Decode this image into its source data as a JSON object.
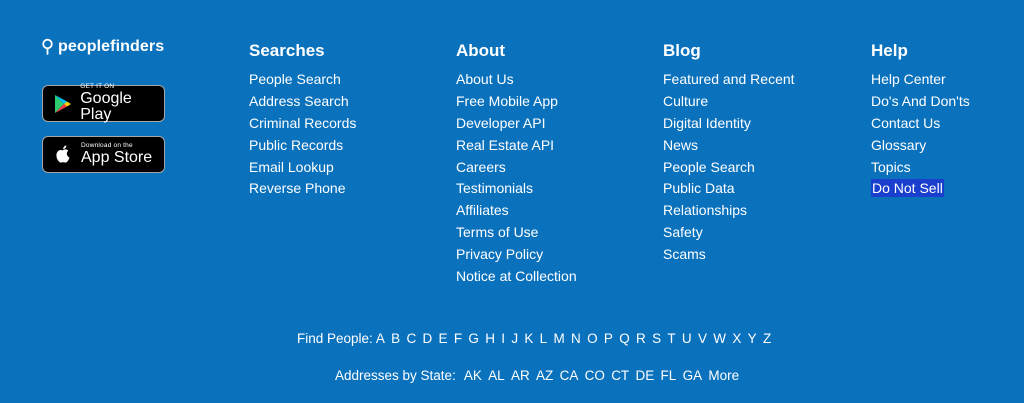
{
  "brand": {
    "name": "peoplefinders",
    "google_play": {
      "small": "GET IT ON",
      "large": "Google Play"
    },
    "app_store": {
      "small": "Download on the",
      "large": "App Store"
    }
  },
  "columns": [
    {
      "title": "Searches",
      "links": [
        "People Search",
        "Address Search",
        "Criminal Records",
        "Public Records",
        "Email Lookup",
        "Reverse Phone"
      ]
    },
    {
      "title": "About",
      "links": [
        "About Us",
        "Free Mobile App",
        "Developer API",
        "Real Estate API",
        "Careers",
        "Testimonials",
        "Affiliates",
        "Terms of Use",
        "Privacy Policy",
        "Notice at Collection"
      ]
    },
    {
      "title": "Blog",
      "links": [
        "Featured and Recent",
        "Culture",
        "Digital Identity",
        "News",
        "People Search",
        "Public Data",
        "Relationships",
        "Safety",
        "Scams"
      ]
    },
    {
      "title": "Help",
      "links": [
        "Help Center",
        "Do's And Don'ts",
        "Contact Us",
        "Glossary",
        "Topics",
        "Do Not Sell"
      ]
    }
  ],
  "find_people": {
    "label": "Find People:",
    "letters": [
      "A",
      "B",
      "C",
      "D",
      "E",
      "F",
      "G",
      "H",
      "I",
      "J",
      "K",
      "L",
      "M",
      "N",
      "O",
      "P",
      "Q",
      "R",
      "S",
      "T",
      "U",
      "V",
      "W",
      "X",
      "Y",
      "Z"
    ]
  },
  "states": {
    "label": "Addresses by State:",
    "items": [
      "AK",
      "AL",
      "AR",
      "AZ",
      "CA",
      "CO",
      "CT",
      "DE",
      "FL",
      "GA",
      "More"
    ]
  },
  "colors": {
    "background": "#0a71bd",
    "text": "#ffffff",
    "selection": "#1a3fcf"
  }
}
